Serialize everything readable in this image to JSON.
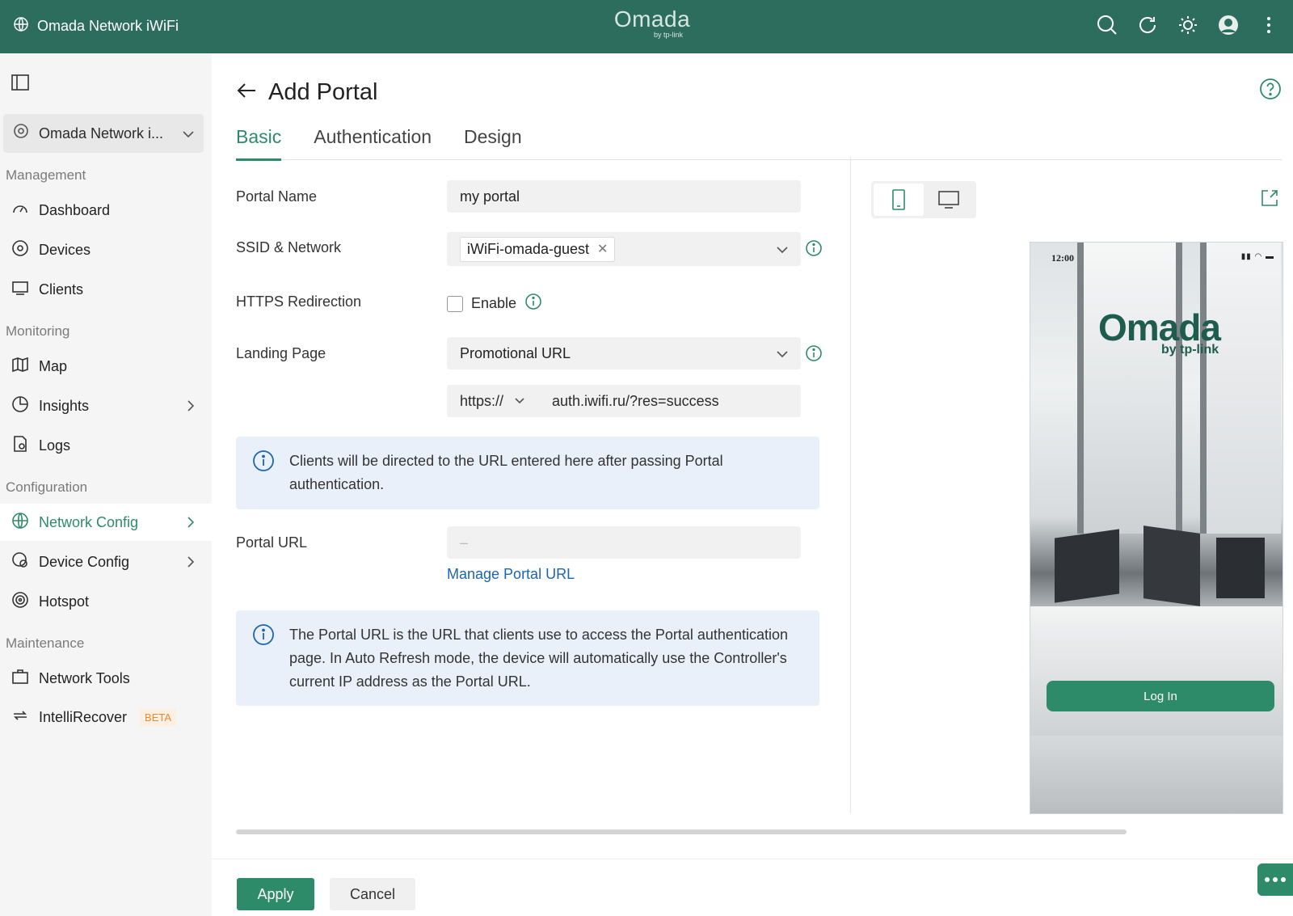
{
  "header": {
    "site_name": "Omada Network iWiFi",
    "logo_text": "Omada",
    "logo_sub": "by tp-link"
  },
  "sidebar": {
    "site_selector": "Omada Network i...",
    "sections": {
      "management": "Management",
      "monitoring": "Monitoring",
      "configuration": "Configuration",
      "maintenance": "Maintenance"
    },
    "items": {
      "dashboard": "Dashboard",
      "devices": "Devices",
      "clients": "Clients",
      "map": "Map",
      "insights": "Insights",
      "logs": "Logs",
      "network_config": "Network Config",
      "device_config": "Device Config",
      "hotspot": "Hotspot",
      "network_tools": "Network Tools",
      "intellirecover": "IntelliRecover",
      "beta_badge": "BETA"
    }
  },
  "page": {
    "title": "Add Portal",
    "tabs": [
      "Basic",
      "Authentication",
      "Design"
    ],
    "active_tab": "Basic"
  },
  "form": {
    "portal_name_label": "Portal Name",
    "portal_name_value": "my portal",
    "ssid_label": "SSID & Network",
    "ssid_chip": "iWiFi-omada-guest",
    "https_label": "HTTPS Redirection",
    "https_enable_label": "Enable",
    "https_enabled": false,
    "landing_label": "Landing Page",
    "landing_value": "Promotional URL",
    "url_protocol": "https://",
    "url_value": "auth.iwifi.ru/?res=success",
    "landing_info": "Clients will be directed to the URL entered here after passing Portal authentication.",
    "portal_url_label": "Portal URL",
    "portal_url_value": "–",
    "manage_link": "Manage Portal URL",
    "portal_url_info": "The Portal URL is the URL that clients use to access the Portal authentication page. In Auto Refresh mode, the device will automatically use the Controller's current IP address as the Portal URL."
  },
  "preview": {
    "time": "12:00",
    "brand": "Omada",
    "brand_sub": "by tp-link",
    "login_button": "Log In",
    "mode": "mobile"
  },
  "footer": {
    "apply": "Apply",
    "cancel": "Cancel"
  },
  "colors": {
    "brand_header": "#2d6d5e",
    "accent": "#2e8b6a",
    "link": "#1c65b0",
    "info_bg": "#e9f0f9",
    "beta": "#e58a3a"
  }
}
